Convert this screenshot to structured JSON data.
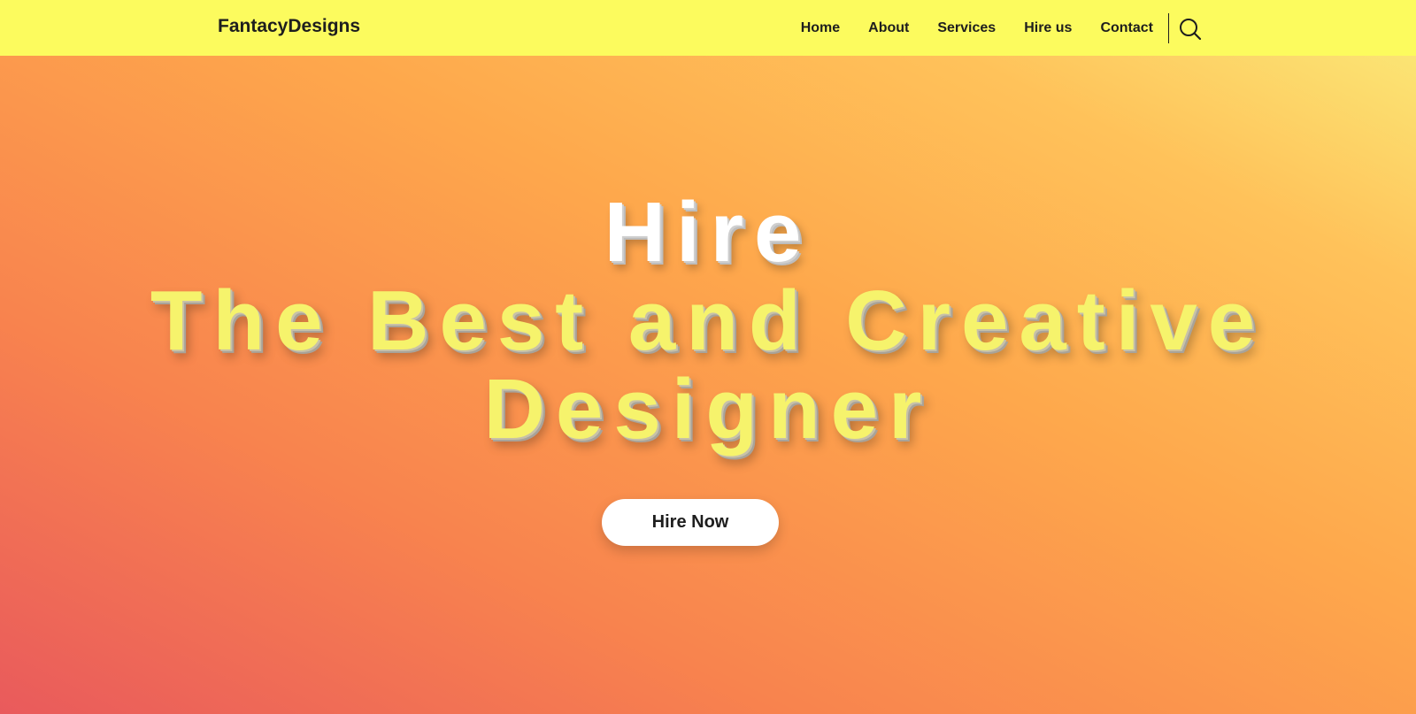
{
  "header": {
    "brand": "FantacyDesigns",
    "nav": [
      {
        "label": "Home"
      },
      {
        "label": "About"
      },
      {
        "label": "Services"
      },
      {
        "label": "Hire us"
      },
      {
        "label": "Contact"
      }
    ],
    "search_icon": "search-icon"
  },
  "hero": {
    "line1": "Hire",
    "line2": "The Best and Creative",
    "line3": "Designer",
    "cta_label": "Hire Now"
  },
  "colors": {
    "navbar": "#fcfb5e",
    "headline_white": "#ffffff",
    "headline_yellow": "#f6f36c",
    "gradient_start": "#e95a5c",
    "gradient_mid": "#fea84c",
    "gradient_end": "#faed7a",
    "button_bg": "#ffffff",
    "text_dark": "#1e1e1e"
  }
}
